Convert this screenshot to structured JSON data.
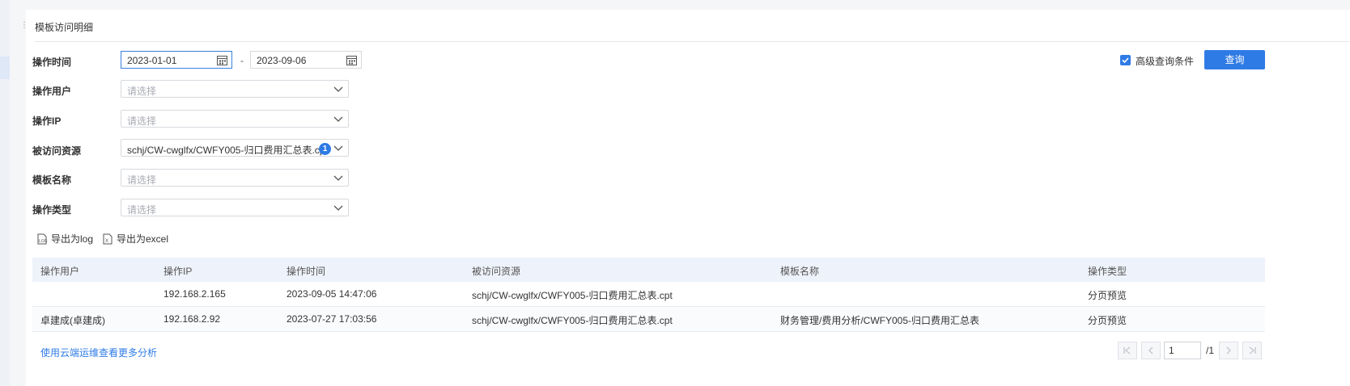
{
  "panel": {
    "title": "模板访问明细"
  },
  "form": {
    "op_time_label": "操作时间",
    "date_start": "2023-01-01",
    "date_separator": "-",
    "date_end": "2023-09-06",
    "op_user_label": "操作用户",
    "op_user_placeholder": "请选择",
    "op_ip_label": "操作IP",
    "op_ip_placeholder": "请选择",
    "resource_label": "被访问资源",
    "resource_value": "schj/CW-cwglfx/CWFY005-归口费用汇总表.cpt",
    "resource_count": "1",
    "template_label": "模板名称",
    "template_placeholder": "请选择",
    "op_type_label": "操作类型",
    "op_type_placeholder": "请选择"
  },
  "advanced": {
    "label": "高级查询条件",
    "checked": true
  },
  "query_button": "查询",
  "export": {
    "log_label": "导出为log",
    "excel_label": "导出为excel"
  },
  "table": {
    "headers": [
      "操作用户",
      "操作IP",
      "操作时间",
      "被访问资源",
      "模板名称",
      "操作类型"
    ],
    "rows": [
      [
        "",
        "192.168.2.165",
        "2023-09-05 14:47:06",
        "schj/CW-cwglfx/CWFY005-归口费用汇总表.cpt",
        "",
        "分页预览"
      ],
      [
        "卓建成(卓建成)",
        "192.168.2.92",
        "2023-07-27 17:03:56",
        "schj/CW-cwglfx/CWFY005-归口费用汇总表.cpt",
        "财务管理/费用分析/CWFY005-归口费用汇总表",
        "分页预览"
      ]
    ]
  },
  "footer_link": "使用云端运维查看更多分析",
  "pagination": {
    "current_page": "1",
    "total": "/1"
  },
  "colors": {
    "accent": "#2f7be6",
    "header_bg": "#eef2fa"
  }
}
